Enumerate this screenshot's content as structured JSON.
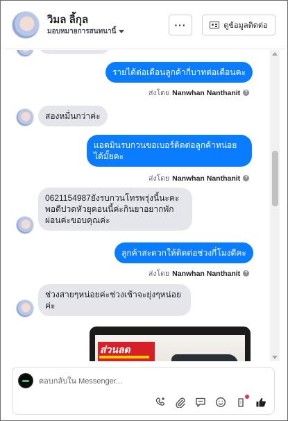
{
  "header": {
    "contact_name": "วิมล ลิ้กุล",
    "assign_label": "มอบหมายการสนทนานี้",
    "more_label": "···",
    "contact_info_label": "ดูข้อมูลติดต่อ"
  },
  "conversation": {
    "sent_by_prefix": "ส่งโดย",
    "sender_name": "Nanwhan Nanthanit",
    "messages": [
      {
        "direction": "out",
        "text": "รายได้ต่อเดือนลูกค้ากี่บาทต่อเดือนคะ"
      },
      {
        "direction": "in",
        "text": "สองหมื่นกว่าค่ะ"
      },
      {
        "direction": "out",
        "text": "แอดมินรบกวนขอเบอร์ติดต่อลูกค้าหน่อยได้มั้ยคะ"
      },
      {
        "direction": "in",
        "text": "0621154987ยังรบกวนโทรพรุ่งนี้นะคะพอดีปวดหัวยุคอนนี้ค่ะกินยาอยากพักผ่อนค่ะขอบคุณค่ะ"
      },
      {
        "direction": "out",
        "text": "ลูกค้าสะดวกให้ติดต่อช่วงกี่โมงดีคะ"
      },
      {
        "direction": "in",
        "text": "ช่วงสายๆหน่อยค่ะช่วงเช้าจะยุ่งๆหน่อยค่ะ"
      }
    ],
    "image_promo_text": "ส่วนลด"
  },
  "composer": {
    "placeholder": "ตอบกลับใน Messenger..."
  },
  "colors": {
    "outgoing_bubble": "#0a7cff",
    "incoming_bubble": "#e4e6eb",
    "like_icon": "#1c1e21",
    "notification_dot": "#f02849"
  },
  "icons": [
    "more-icon",
    "contact-card-icon",
    "caret-down-icon",
    "help-icon",
    "add-contact-icon",
    "attachment-icon",
    "saved-replies-icon",
    "emoji-icon",
    "order-icon",
    "thumbs-up-icon"
  ]
}
